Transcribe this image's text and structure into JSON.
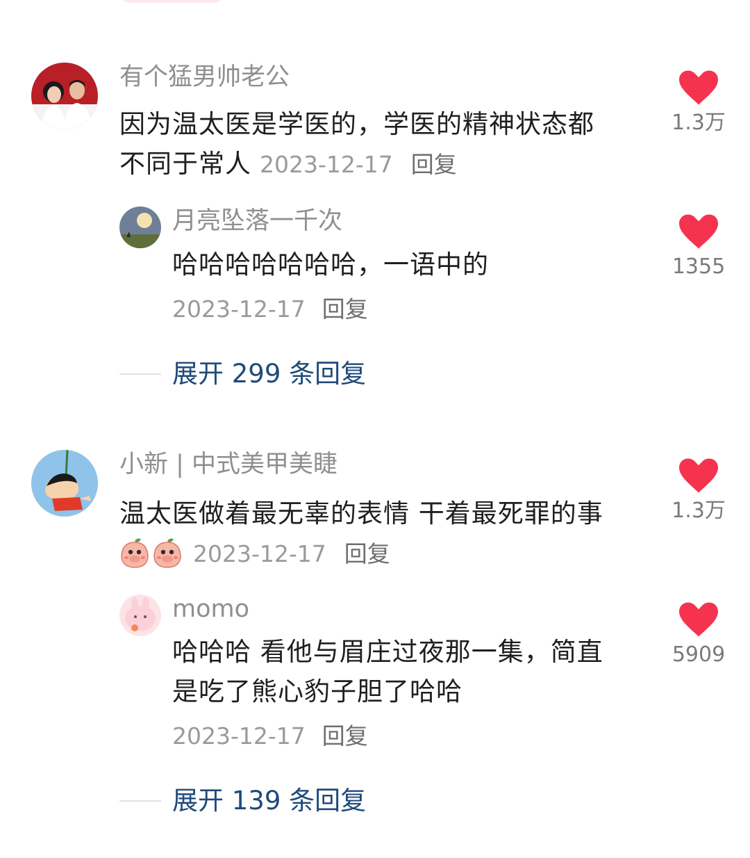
{
  "colors": {
    "like_red": "#f5334f",
    "expand_blue": "#1f4a7a",
    "name_gray": "#8f8f8f"
  },
  "comments": [
    {
      "name": "有个猛男帅老公",
      "content": "因为温太医是学医的，学医的精神状态都不同于常人",
      "date": "2023-12-17",
      "reply_label": "回复",
      "likes": "1.3万",
      "avatar": "couple-photo-avatar",
      "replies": [
        {
          "name": "月亮坠落一千次",
          "content": "哈哈哈哈哈哈哈，一语中的",
          "date": "2023-12-17",
          "reply_label": "回复",
          "likes": "1355",
          "avatar": "moon-landscape-avatar"
        }
      ],
      "expand_label": "展开 299 条回复"
    },
    {
      "name": "小新 | 中式美甲美睫",
      "content": "温太医做着最无辜的表情 干着最死罪的事",
      "emoji": [
        "peach-covering-mouth-emoji",
        "peach-covering-mouth-emoji"
      ],
      "date": "2023-12-17",
      "reply_label": "回复",
      "likes": "1.3万",
      "avatar": "cartoon-boy-sky-avatar",
      "replies": [
        {
          "name": "momo",
          "content": "哈哈哈 看他与眉庄过夜那一集，简直是吃了熊心豹子胆了哈哈",
          "date": "2023-12-17",
          "reply_label": "回复",
          "likes": "5909",
          "avatar": "pink-bunny-avatar"
        }
      ],
      "expand_label": "展开 139 条回复"
    }
  ]
}
